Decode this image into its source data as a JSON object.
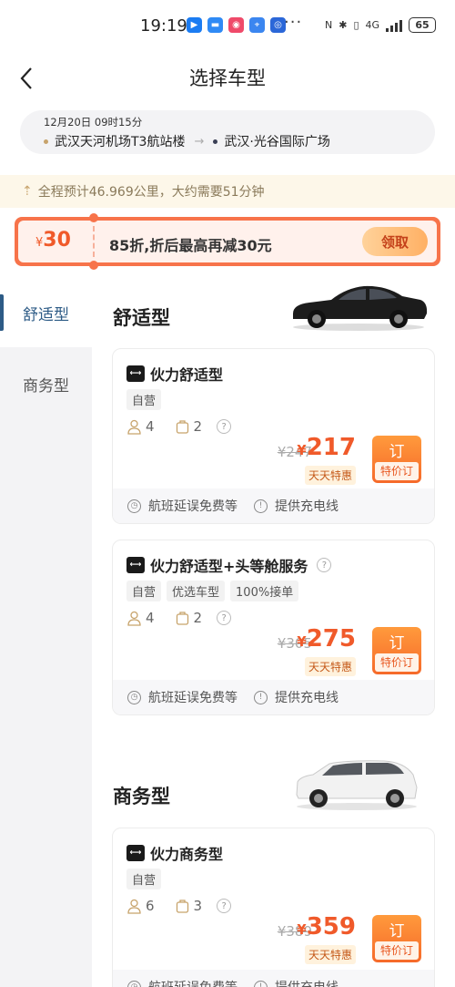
{
  "status_bar": {
    "time": "19:19",
    "more": "···",
    "network": "4G",
    "battery": "65"
  },
  "header": {
    "title": "选择车型"
  },
  "route": {
    "time": "12月20日 09时15分",
    "from": "武汉天河机场T3航站楼",
    "arrow": "→",
    "to": "武汉·光谷国际广场"
  },
  "estimate": {
    "text": "全程预计46.969公里，大约需要51分钟"
  },
  "coupon": {
    "currency": "¥",
    "amount": "30",
    "text": "85折,折后最高再减30元",
    "button": "领取"
  },
  "sidebar": {
    "items": [
      {
        "label": "舒适型",
        "active": true
      },
      {
        "label": "商务型",
        "active": false
      }
    ]
  },
  "sections": [
    {
      "title": "舒适型"
    },
    {
      "title": "商务型"
    }
  ],
  "cards": [
    {
      "name": "伙力舒适型",
      "tags": [
        "自营"
      ],
      "passengers": "4",
      "luggage": "2",
      "help": "?",
      "old_price": "¥247",
      "currency": "¥",
      "price": "217",
      "badge": "天天特惠",
      "order": "订",
      "order_sub": "特价订",
      "features": [
        "航班延误免费等",
        "提供充电线"
      ]
    },
    {
      "name": "伙力舒适型+头等舱服务",
      "tags": [
        "自营",
        "优选车型",
        "100%接单"
      ],
      "passengers": "4",
      "luggage": "2",
      "help": "?",
      "old_price": "¥305",
      "currency": "¥",
      "price": "275",
      "badge": "天天特惠",
      "order": "订",
      "order_sub": "特价订",
      "features": [
        "航班延误免费等",
        "提供充电线"
      ]
    },
    {
      "name": "伙力商务型",
      "tags": [
        "自营"
      ],
      "passengers": "6",
      "luggage": "3",
      "help": "?",
      "old_price": "¥389",
      "currency": "¥",
      "price": "359",
      "badge": "天天特惠",
      "order": "订",
      "order_sub": "特价订",
      "features": [
        "航班延误免费等",
        "提供充电线"
      ]
    }
  ],
  "colors": {
    "accent": "#f05a2a",
    "sidebar_active": "#2d5b86",
    "coupon_border": "#f7734a"
  }
}
